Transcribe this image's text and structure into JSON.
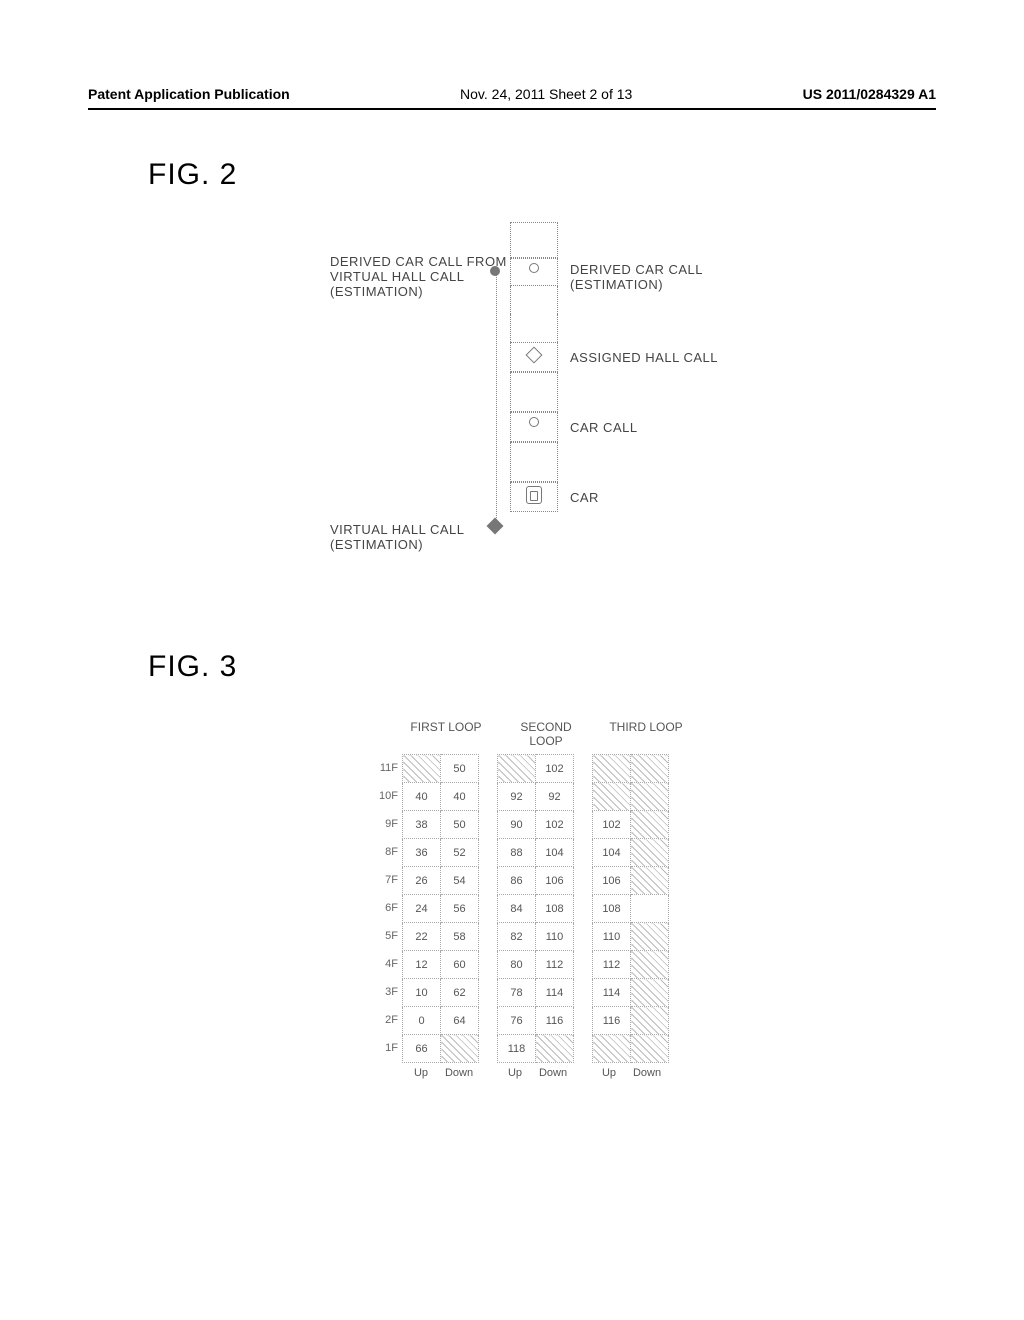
{
  "header": {
    "left": "Patent Application Publication",
    "center": "Nov. 24, 2011  Sheet 2 of 13",
    "right": "US 2011/0284329 A1"
  },
  "fig2": {
    "label": "FIG. 2",
    "annotations": {
      "derived_from_virtual": "DERIVED CAR CALL FROM\nVIRTUAL HALL CALL\n(ESTIMATION)",
      "derived_car_call": "DERIVED CAR CALL\n(ESTIMATION)",
      "assigned_hall_call": "ASSIGNED HALL CALL",
      "car_call": "CAR CALL",
      "car": "CAR",
      "virtual_hall_call": "VIRTUAL HALL CALL\n(ESTIMATION)"
    }
  },
  "fig3": {
    "label": "FIG. 3",
    "headers": [
      "FIRST LOOP",
      "SECOND LOOP",
      "THIRD LOOP"
    ],
    "floors": [
      "11F",
      "10F",
      "9F",
      "8F",
      "7F",
      "6F",
      "5F",
      "4F",
      "3F",
      "2F",
      "1F"
    ],
    "updown": {
      "up": "Up",
      "down": "Down"
    }
  },
  "chart_data": [
    {
      "type": "table",
      "title": "FIRST LOOP",
      "columns": [
        "Up",
        "Down"
      ],
      "rows": [
        {
          "floor": "11F",
          "up": null,
          "down": "50",
          "up_hatched": true
        },
        {
          "floor": "10F",
          "up": "40",
          "down": "40"
        },
        {
          "floor": "9F",
          "up": "38",
          "down": "50"
        },
        {
          "floor": "8F",
          "up": "36",
          "down": "52"
        },
        {
          "floor": "7F",
          "up": "26",
          "down": "54"
        },
        {
          "floor": "6F",
          "up": "24",
          "down": "56"
        },
        {
          "floor": "5F",
          "up": "22",
          "down": "58"
        },
        {
          "floor": "4F",
          "up": "12",
          "down": "60"
        },
        {
          "floor": "3F",
          "up": "10",
          "down": "62"
        },
        {
          "floor": "2F",
          "up": "0",
          "down": "64"
        },
        {
          "floor": "1F",
          "up": "66",
          "down": null,
          "down_hatched": true
        }
      ]
    },
    {
      "type": "table",
      "title": "SECOND LOOP",
      "columns": [
        "Up",
        "Down"
      ],
      "rows": [
        {
          "floor": "11F",
          "up": null,
          "down": "102",
          "up_hatched": true
        },
        {
          "floor": "10F",
          "up": "92",
          "down": "92"
        },
        {
          "floor": "9F",
          "up": "90",
          "down": "102"
        },
        {
          "floor": "8F",
          "up": "88",
          "down": "104"
        },
        {
          "floor": "7F",
          "up": "86",
          "down": "106"
        },
        {
          "floor": "6F",
          "up": "84",
          "down": "108"
        },
        {
          "floor": "5F",
          "up": "82",
          "down": "110"
        },
        {
          "floor": "4F",
          "up": "80",
          "down": "112"
        },
        {
          "floor": "3F",
          "up": "78",
          "down": "114"
        },
        {
          "floor": "2F",
          "up": "76",
          "down": "116"
        },
        {
          "floor": "1F",
          "up": "118",
          "down": null,
          "down_hatched": true
        }
      ]
    },
    {
      "type": "table",
      "title": "THIRD LOOP",
      "columns": [
        "Up",
        "Down"
      ],
      "rows": [
        {
          "floor": "11F",
          "up": null,
          "down": null,
          "up_hatched": true,
          "down_hatched": true
        },
        {
          "floor": "10F",
          "up": null,
          "down": null,
          "up_hatched": true,
          "down_hatched": true
        },
        {
          "floor": "9F",
          "up": "102",
          "down": null,
          "down_hatched": true
        },
        {
          "floor": "8F",
          "up": "104",
          "down": null,
          "down_hatched": true
        },
        {
          "floor": "7F",
          "up": "106",
          "down": null,
          "down_hatched": true
        },
        {
          "floor": "6F",
          "up": "108",
          "down": ""
        },
        {
          "floor": "5F",
          "up": "110",
          "down": null,
          "down_hatched": true
        },
        {
          "floor": "4F",
          "up": "112",
          "down": null,
          "down_hatched": true
        },
        {
          "floor": "3F",
          "up": "114",
          "down": null,
          "down_hatched": true
        },
        {
          "floor": "2F",
          "up": "116",
          "down": null,
          "down_hatched": true
        },
        {
          "floor": "1F",
          "up": null,
          "down": null,
          "up_hatched": true,
          "down_hatched": true
        }
      ]
    }
  ]
}
